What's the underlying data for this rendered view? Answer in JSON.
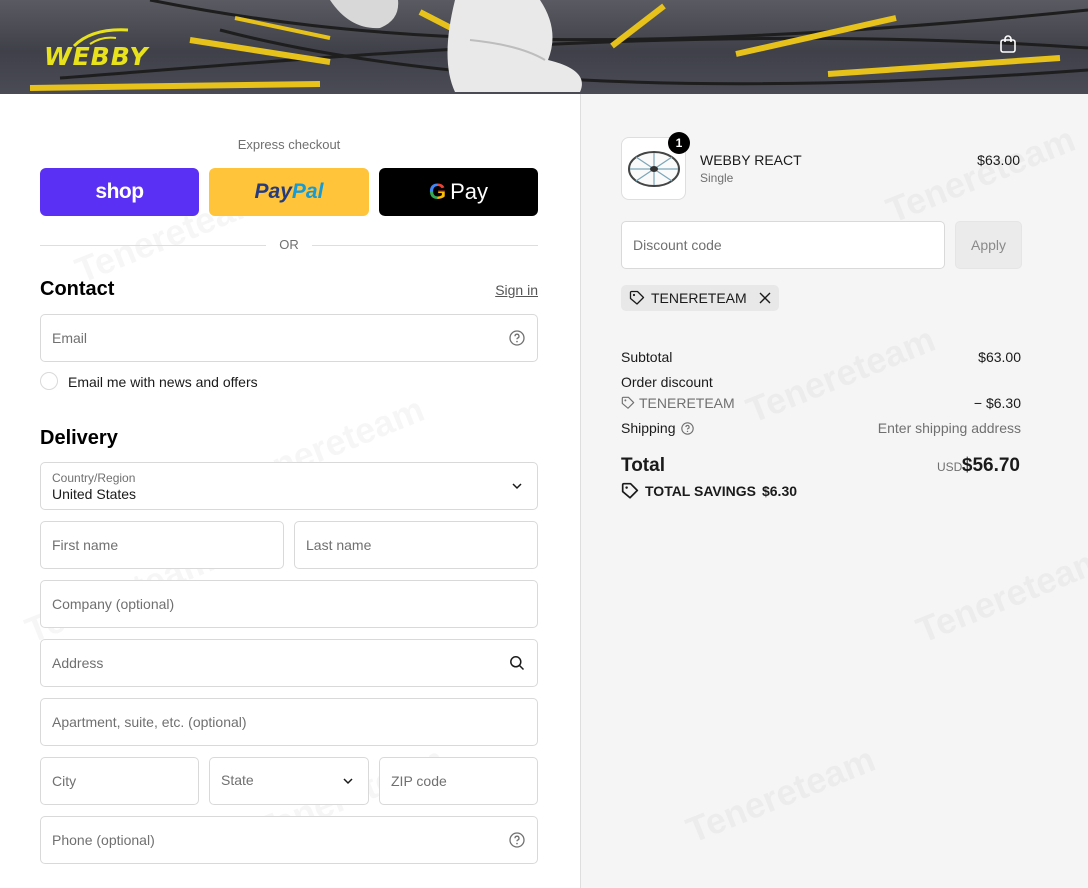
{
  "brand": {
    "logo_text": "WEBBY",
    "accent": "#e8e21c"
  },
  "header": {
    "cart_icon": "shopping-bag-icon"
  },
  "express": {
    "label": "Express checkout",
    "shop_label": "shop",
    "paypal_label_1": "Pay",
    "paypal_label_2": "Pal",
    "gpay_label": "Pay",
    "divider_label": "OR"
  },
  "contact": {
    "title": "Contact",
    "sign_in": "Sign in",
    "email_placeholder": "Email",
    "newsletter_label": "Email me with news and offers"
  },
  "delivery": {
    "title": "Delivery",
    "country_label": "Country/Region",
    "country_value": "United States",
    "first_name": "First name",
    "last_name": "Last name",
    "company": "Company (optional)",
    "address": "Address",
    "apartment": "Apartment, suite, etc. (optional)",
    "city": "City",
    "state": "State",
    "zip": "ZIP code",
    "phone": "Phone (optional)"
  },
  "order": {
    "product_name": "WEBBY REACT",
    "product_variant": "Single",
    "product_price": "$63.00",
    "quantity": "1",
    "discount_placeholder": "Discount code",
    "apply_label": "Apply",
    "applied_code": "TENERETEAM",
    "subtotal_label": "Subtotal",
    "subtotal_value": "$63.00",
    "order_discount_label": "Order discount",
    "discount_code": "TENERETEAM",
    "discount_value": "− $6.30",
    "shipping_label": "Shipping",
    "shipping_value": "Enter shipping address",
    "total_label": "Total",
    "currency": "USD",
    "total_value": "$56.70",
    "savings_label": "TOTAL SAVINGS",
    "savings_value": "$6.30"
  },
  "watermark": "Tenereteam"
}
